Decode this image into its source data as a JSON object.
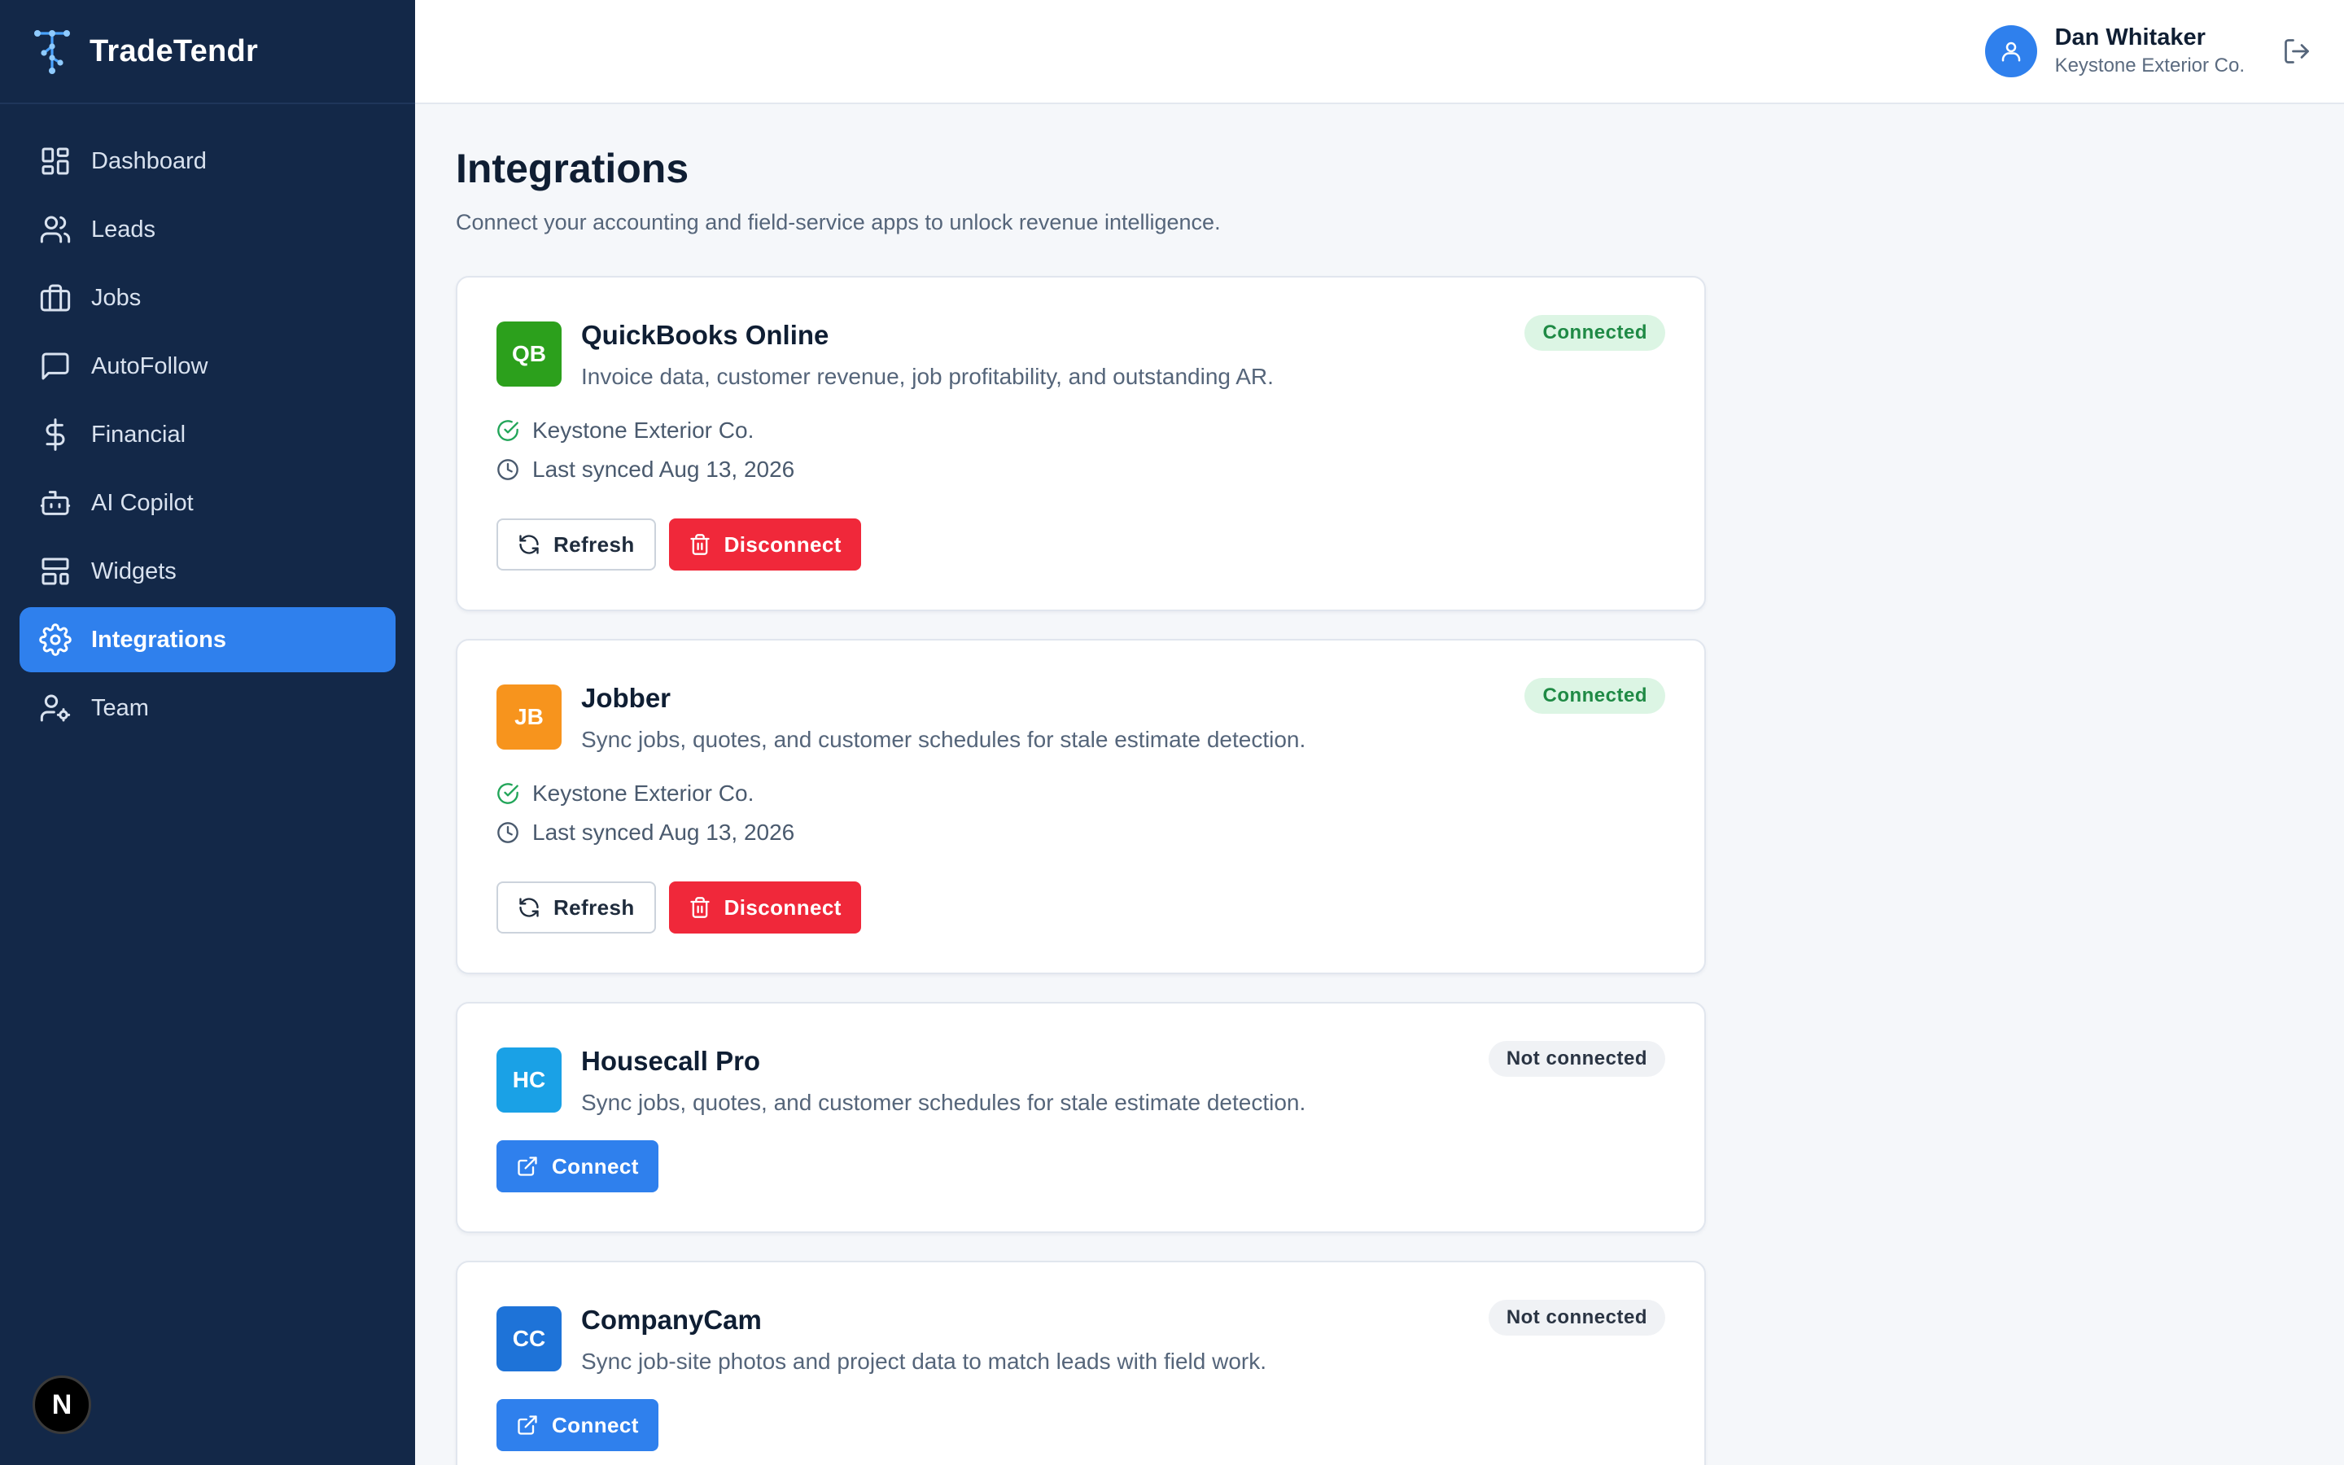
{
  "app": {
    "name": "TradeTendr"
  },
  "sidebar": {
    "items": [
      {
        "label": "Dashboard",
        "icon": "dashboard-icon",
        "active": false
      },
      {
        "label": "Leads",
        "icon": "users-icon",
        "active": false
      },
      {
        "label": "Jobs",
        "icon": "briefcase-icon",
        "active": false
      },
      {
        "label": "AutoFollow",
        "icon": "message-icon",
        "active": false
      },
      {
        "label": "Financial",
        "icon": "dollar-icon",
        "active": false
      },
      {
        "label": "AI Copilot",
        "icon": "bot-icon",
        "active": false
      },
      {
        "label": "Widgets",
        "icon": "layout-icon",
        "active": false
      },
      {
        "label": "Integrations",
        "icon": "gear-icon",
        "active": true
      },
      {
        "label": "Team",
        "icon": "user-cog-icon",
        "active": false
      }
    ],
    "footer_badge": "N"
  },
  "header": {
    "user_name": "Dan Whitaker",
    "user_company": "Keystone Exterior Co."
  },
  "page": {
    "title": "Integrations",
    "subtitle": "Connect your accounting and field-service apps to unlock revenue intelligence."
  },
  "integrations": [
    {
      "abbr": "QB",
      "name": "QuickBooks Online",
      "description": "Invoice data, customer revenue, job profitability, and outstanding AR.",
      "status": "Connected",
      "account": "Keystone Exterior Co.",
      "last_synced": "Last synced Aug 13, 2026",
      "refresh_label": "Refresh",
      "disconnect_label": "Disconnect",
      "color": "#2ca01c"
    },
    {
      "abbr": "JB",
      "name": "Jobber",
      "description": "Sync jobs, quotes, and customer schedules for stale estimate detection.",
      "status": "Connected",
      "account": "Keystone Exterior Co.",
      "last_synced": "Last synced Aug 13, 2026",
      "refresh_label": "Refresh",
      "disconnect_label": "Disconnect",
      "color": "#f7941d"
    },
    {
      "abbr": "HC",
      "name": "Housecall Pro",
      "description": "Sync jobs, quotes, and customer schedules for stale estimate detection.",
      "status": "Not connected",
      "connect_label": "Connect",
      "color": "#1aa1e6"
    },
    {
      "abbr": "CC",
      "name": "CompanyCam",
      "description": "Sync job-site photos and project data to match leads with field work.",
      "status": "Not connected",
      "connect_label": "Connect",
      "color": "#1e73d8"
    }
  ],
  "colors": {
    "sidebar_bg": "#132848",
    "accent": "#2f80ed",
    "danger": "#f0283a",
    "success": "#1f8a45"
  }
}
